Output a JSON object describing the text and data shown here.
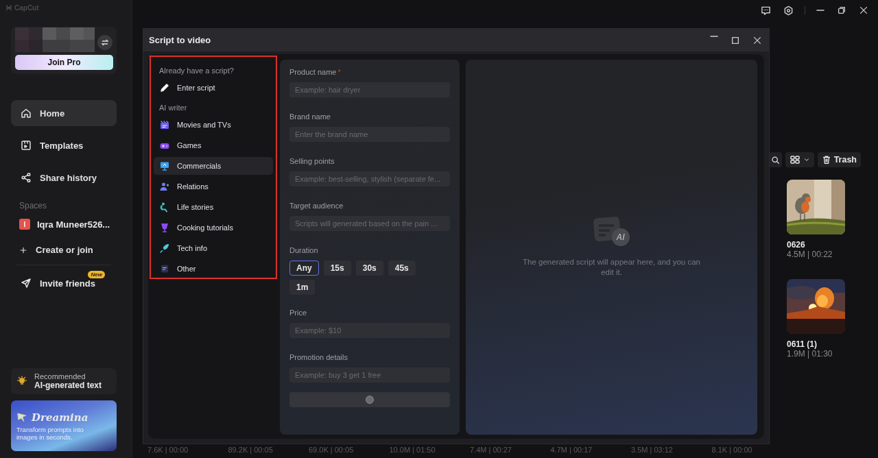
{
  "app": {
    "name": "CapCut"
  },
  "account": {
    "join_label": "Join Pro"
  },
  "nav": [
    {
      "label": "Home",
      "selected": true
    },
    {
      "label": "Templates",
      "selected": false
    },
    {
      "label": "Share history",
      "selected": false
    }
  ],
  "spaces": {
    "heading": "Spaces",
    "items": [
      {
        "initial": "I",
        "name": "Iqra Muneer526...",
        "color": "#e5534b"
      }
    ],
    "create_label": "Create or join"
  },
  "invite": {
    "label": "Invite friends",
    "badge": "New"
  },
  "recommended": {
    "caption": "Recommended",
    "title": "AI-generated text"
  },
  "promo": {
    "title": "Dreamina",
    "text": "Transform prompts into images in seconds."
  },
  "toolbar": {
    "trash_label": "Trash"
  },
  "media": [
    {
      "title": "0626",
      "meta": "4.5M | 00:22"
    },
    {
      "title": "0611 (1)",
      "meta": "1.9M | 01:30"
    }
  ],
  "stats_row": [
    "7.6K | 00:00",
    "89.2K | 00:05",
    "69.0K | 00:05",
    "10.0M | 01:50",
    "7.4M | 00:27",
    "4.7M | 00:17",
    "3.5M | 03:12",
    "8.1K | 00:00"
  ],
  "dialog": {
    "title": "Script to video",
    "menu_sections": [
      {
        "heading": "Already have a script?",
        "items": [
          {
            "label": "Enter script",
            "selected": false
          }
        ]
      },
      {
        "heading": "AI writer",
        "items": [
          {
            "label": "Movies and TVs",
            "selected": false
          },
          {
            "label": "Games",
            "selected": false
          },
          {
            "label": "Commercials",
            "selected": true
          },
          {
            "label": "Relations",
            "selected": false
          },
          {
            "label": "Life stories",
            "selected": false
          },
          {
            "label": "Cooking tutorials",
            "selected": false
          },
          {
            "label": "Tech info",
            "selected": false
          },
          {
            "label": "Other",
            "selected": false
          }
        ]
      }
    ],
    "form": [
      {
        "kind": "field",
        "label": "Product name",
        "required_mark": "*",
        "placeholder": "Example: hair dryer"
      },
      {
        "kind": "field",
        "label": "Brand name",
        "placeholder": "Enter the brand name"
      },
      {
        "kind": "field",
        "label": "Selling points",
        "placeholder": "Example: best-selling, stylish (separate fe..."
      },
      {
        "kind": "field",
        "label": "Target audience",
        "placeholder": "Scripts will generated based on the pain ..."
      },
      {
        "kind": "choices",
        "label": "Duration",
        "options": [
          {
            "label": "Any",
            "selected": true
          },
          {
            "label": "15s",
            "selected": false
          },
          {
            "label": "30s",
            "selected": false
          },
          {
            "label": "45s",
            "selected": false
          },
          {
            "label": "1m",
            "selected": false
          }
        ]
      },
      {
        "kind": "field",
        "label": "Price",
        "placeholder": "Example: $10"
      },
      {
        "kind": "field",
        "label": "Promotion details",
        "placeholder": "Example: buy 3 get 1 free"
      }
    ],
    "preview": {
      "badge": "AI",
      "message": "The generated script will appear here, and you can edit it."
    }
  }
}
